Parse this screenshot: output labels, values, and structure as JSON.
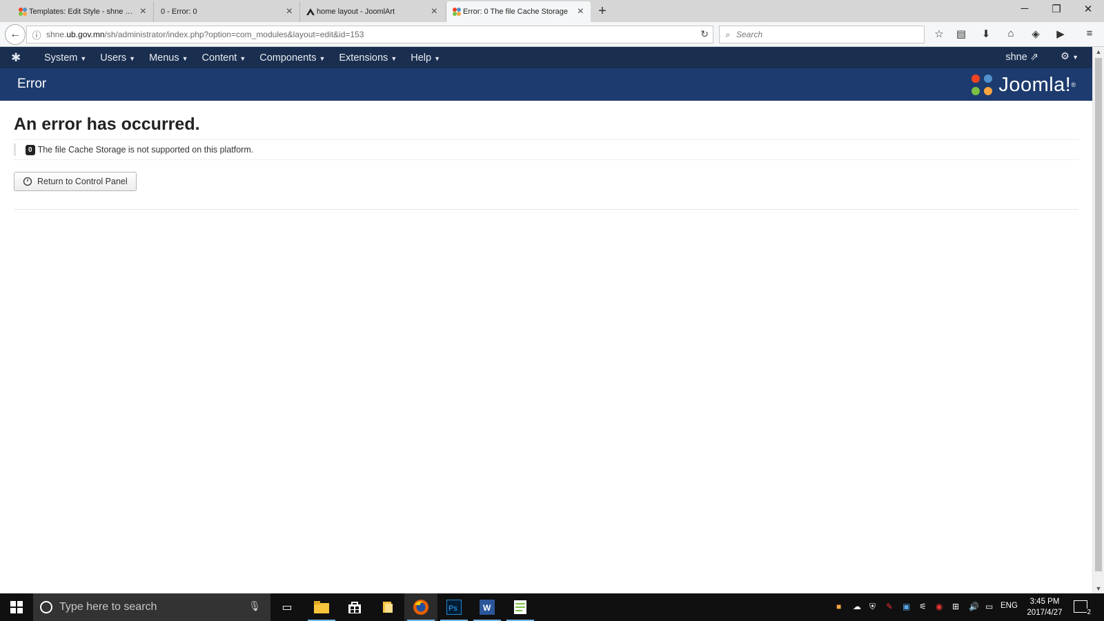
{
  "browser": {
    "tabs": [
      {
        "title": "Templates: Edit Style - shne - A",
        "active": false
      },
      {
        "title": "0 - Error: 0",
        "active": false
      },
      {
        "title": "home layout - JoomlArt",
        "active": false
      },
      {
        "title": "Error: 0 The file Cache Storage",
        "active": true
      }
    ],
    "url_prefix": "shne.",
    "url_host": "ub.gov.mn",
    "url_path": "/sh/administrator/index.php?option=com_modules&layout=edit&id=153",
    "search_placeholder": "Search"
  },
  "joomla": {
    "menu": [
      "System",
      "Users",
      "Menus",
      "Content",
      "Components",
      "Extensions",
      "Help"
    ],
    "user": "shne",
    "page_title": "Error",
    "brand": "Joomla!"
  },
  "error": {
    "heading": "An error has occurred.",
    "code": "0",
    "message": "The file Cache Storage is not supported on this platform.",
    "return_label": "Return to Control Panel"
  },
  "taskbar": {
    "search_placeholder": "Type here to search",
    "lang": "ENG",
    "time": "3:45 PM",
    "date": "2017/4/27",
    "notifications": "2"
  },
  "colors": {
    "joomla_nav": "#1a2e4f",
    "joomla_header": "#1d3b6e",
    "taskbar": "#101010"
  }
}
